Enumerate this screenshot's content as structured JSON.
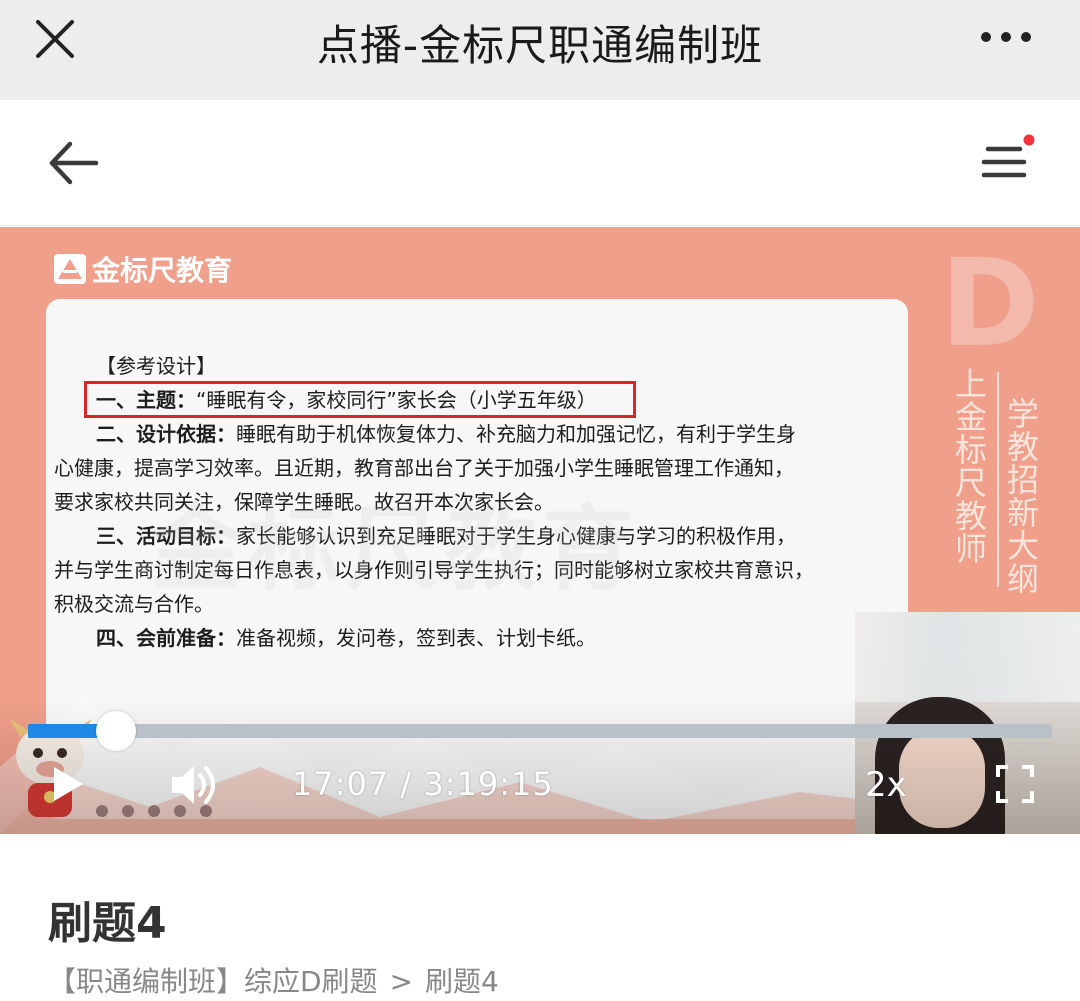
{
  "titlebar": {
    "title": "点播-金标尺职通编制班"
  },
  "video": {
    "logo_text": "金标尺教育",
    "side_letter": "D",
    "side_text_1": "上金标尺教师",
    "side_text_2": "学教招新大纲",
    "watermark": "金标尺教育",
    "slide": {
      "heading": "【参考设计】",
      "line1_label": "一、主题：",
      "line1_text": "“睡眠有令，家校同行”家长会（小学五年级）",
      "line2_label": "二、设计依据：",
      "line2_text": "睡眠有助于机体恢复体力、补充脑力和加强记忆，有利于学生身",
      "line3": "心健康，提高学习效率。且近期，教育部出台了关于加强小学生睡眠管理工作通知，",
      "line4": "要求家校共同关注，保障学生睡眠。故召开本次家长会。",
      "line5_label": "三、活动目标：",
      "line5_text": "家长能够认识到充足睡眠对于学生身心健康与学习的积极作用，",
      "line6": "并与学生商讨制定每日作息表，以身作则引导学生执行；同时能够树立家校共育意识，",
      "line7": "积极交流与合作。",
      "line8_label": "四、会前准备：",
      "line8_text": "准备视频，发问卷，签到表、计划卡纸。"
    },
    "controls": {
      "time": "17:07 / 3:19:15",
      "speed": "2x",
      "progress_fraction": 0.086
    }
  },
  "lesson": {
    "title": "刷题4",
    "breadcrumb": {
      "parent": "【职通编制班】综应D刷题",
      "separator": ">",
      "current": "刷题4"
    }
  },
  "colors": {
    "accent": "#1e88e5",
    "video_bg": "#ef9f8a",
    "highlight": "#d7262c",
    "notification_dot": "#f5333f"
  }
}
